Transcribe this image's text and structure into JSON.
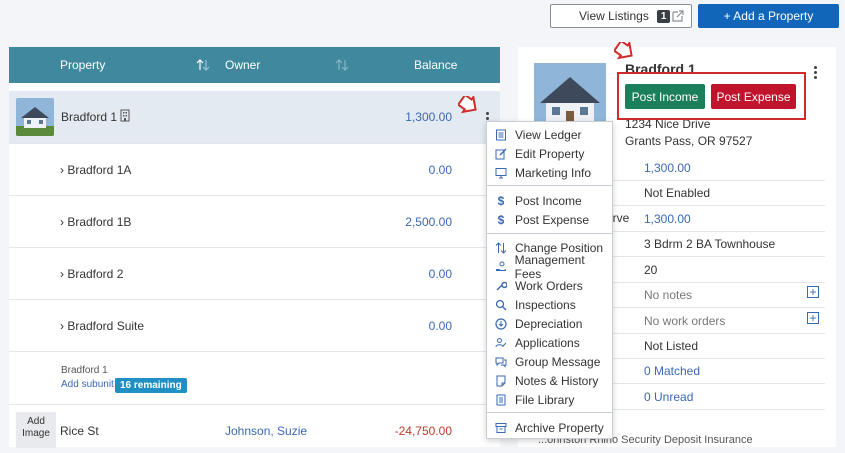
{
  "header": {
    "view_listings_label": "View Listings",
    "view_listings_count": "1",
    "add_property_label": "+ Add a Property"
  },
  "table": {
    "col_property": "Property",
    "col_owner": "Owner",
    "col_balance": "Balance",
    "main_row": {
      "name": "Bradford 1",
      "balance": "1,300.00"
    },
    "subunits": [
      {
        "name": "› Bradford 1A",
        "balance": "0.00"
      },
      {
        "name": "› Bradford 1B",
        "balance": "2,500.00"
      },
      {
        "name": "› Bradford 2",
        "balance": "0.00"
      },
      {
        "name": "› Bradford Suite",
        "balance": "0.00"
      }
    ],
    "footer": {
      "parent_label": "Bradford 1",
      "add_subunit_label": "Add subunit",
      "remaining_badge": "16 remaining"
    },
    "next_row": {
      "add_image_label": "Add Image",
      "name": "Rice St",
      "owner": "Johnson, Suzie",
      "balance": "-24,750.00"
    }
  },
  "menu": {
    "items": [
      {
        "label": "View Ledger",
        "icon": "ledger-icon"
      },
      {
        "label": "Edit Property",
        "icon": "edit-icon"
      },
      {
        "label": "Marketing Info",
        "icon": "monitor-icon"
      },
      {
        "label": "Post Income",
        "icon": "dollar-icon"
      },
      {
        "label": "Post Expense",
        "icon": "dollar-icon"
      },
      {
        "label": "Change Position",
        "icon": "sort-icon"
      },
      {
        "label": "Management Fees",
        "icon": "hand-coin-icon"
      },
      {
        "label": "Work Orders",
        "icon": "wrench-icon"
      },
      {
        "label": "Inspections",
        "icon": "magnifier-icon"
      },
      {
        "label": "Depreciation",
        "icon": "down-circle-icon"
      },
      {
        "label": "Applications",
        "icon": "user-edit-icon"
      },
      {
        "label": "Group Message",
        "icon": "chat-icon"
      },
      {
        "label": "Notes & History",
        "icon": "note-icon"
      },
      {
        "label": "File Library",
        "icon": "file-icon"
      },
      {
        "label": "Archive Property",
        "icon": "archive-icon"
      }
    ]
  },
  "panel": {
    "title": "Bradford 1",
    "post_income_label": "Post Income",
    "post_expense_label": "Post Expense",
    "address_line1": "1234 Nice Drive",
    "address_line2": "Grants Pass, OR 97527",
    "rows": [
      {
        "label": "",
        "value": "1,300.00"
      },
      {
        "label": "e",
        "value": "Not Enabled"
      },
      {
        "label": "erve",
        "value": "1,300.00"
      },
      {
        "label": "",
        "value": "3 Bdrm 2 BA Townhouse"
      },
      {
        "label": "",
        "value": "20"
      },
      {
        "label": "",
        "value": "No notes"
      },
      {
        "label": "",
        "value": "No work orders"
      },
      {
        "label": "",
        "value": "Not Listed"
      },
      {
        "label": "",
        "value": "0 Matched"
      },
      {
        "label": "",
        "value": "0 Unread"
      }
    ],
    "bottom_text": "...ohnston Rhino Security Deposit Insurance"
  },
  "colors": {
    "primary": "#1266b9",
    "table_header": "#3f889e",
    "income": "#1a7f5a",
    "expense": "#c0132c",
    "highlight": "#d12a2a",
    "link": "#3a68b5"
  }
}
